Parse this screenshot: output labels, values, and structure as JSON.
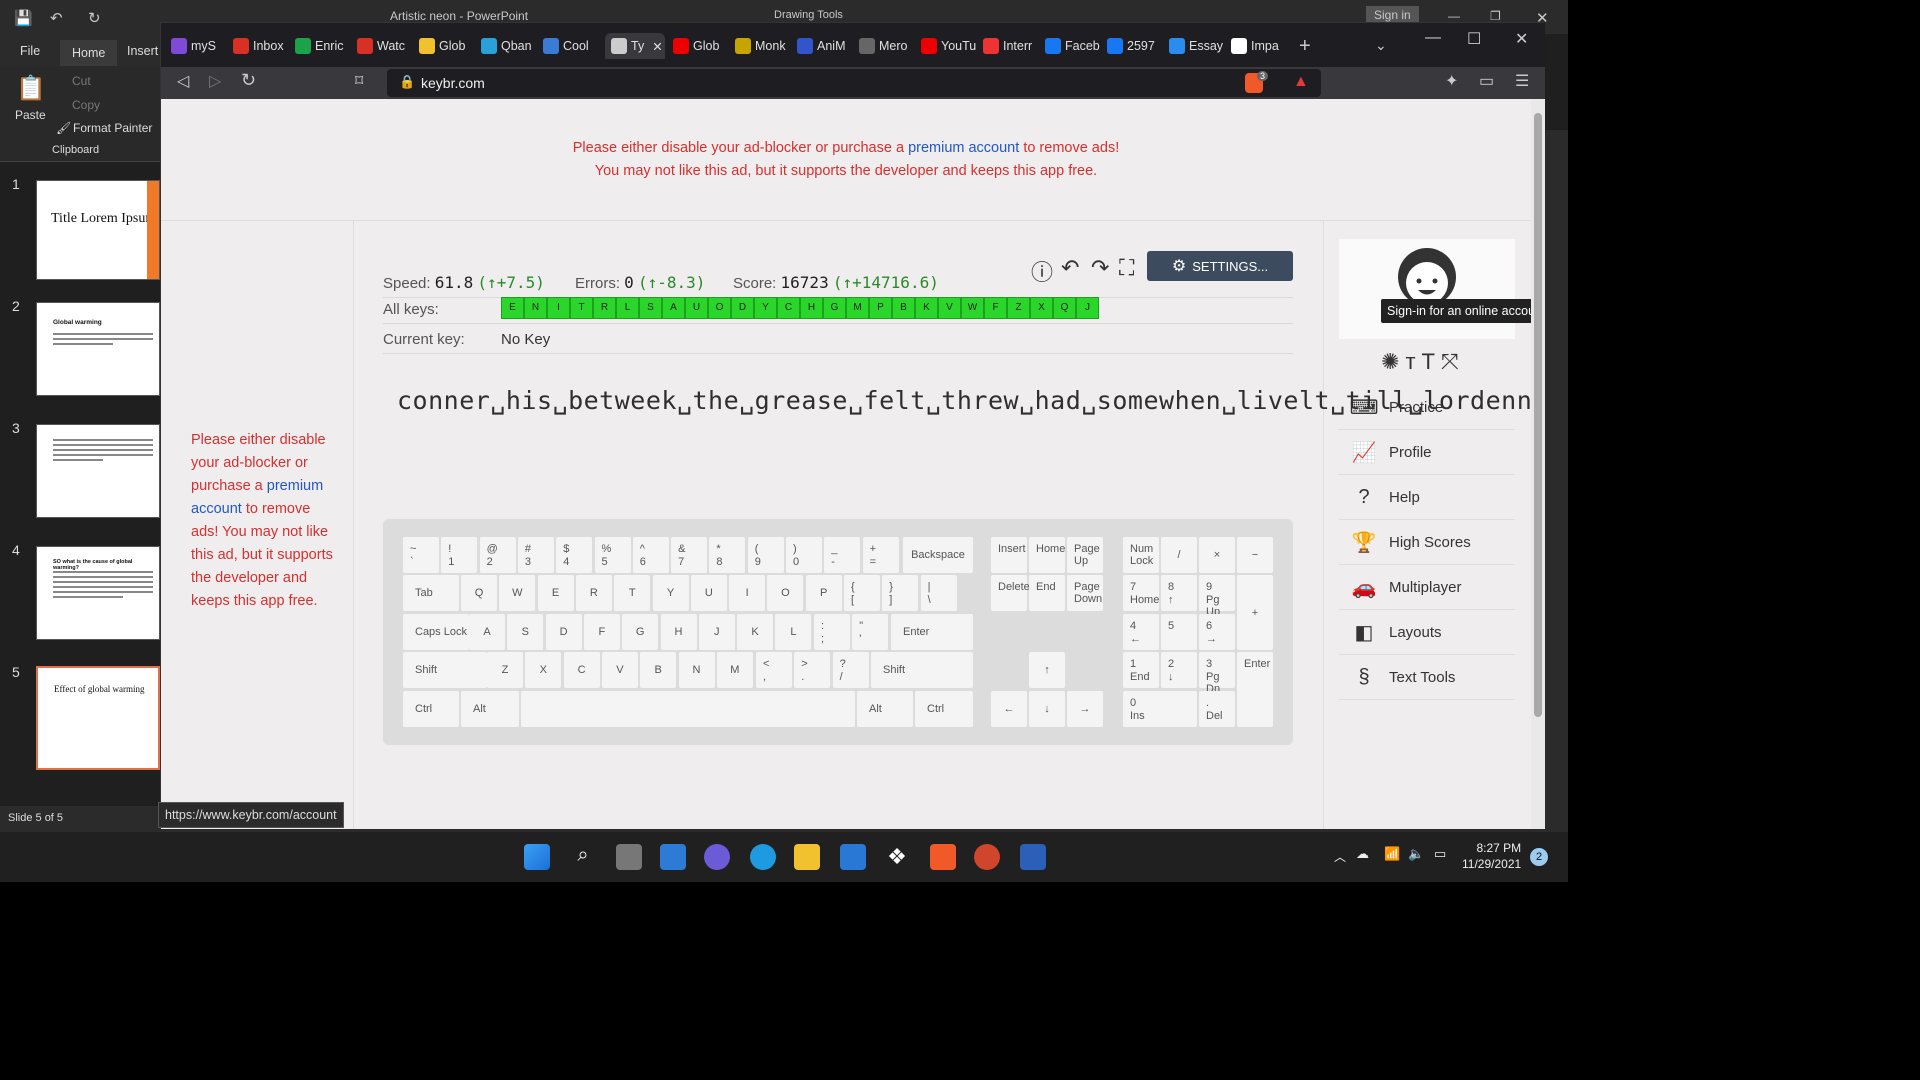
{
  "powerpoint": {
    "title": "Artistic neon  -  PowerPoint",
    "drawing_tools": "Drawing Tools",
    "sign_in": "Sign in",
    "tabs": [
      "File",
      "Home",
      "Insert"
    ],
    "clipboard": {
      "paste": "Paste",
      "cut": "Cut",
      "copy": "Copy",
      "format_painter": "Format Painter",
      "group": "Clipboard"
    },
    "slides": [
      {
        "num": "1",
        "title": "Title Lorem Ipsum"
      },
      {
        "num": "2",
        "title": "Global warming"
      },
      {
        "num": "3",
        "title": ""
      },
      {
        "num": "4",
        "title": "SO what is the cause of global warming?"
      },
      {
        "num": "5",
        "title": "Effect of global warming"
      }
    ],
    "status": "Slide 5 of 5"
  },
  "browser": {
    "tabs": [
      "myS",
      "Inbox",
      "Enric",
      "Watc",
      "Glob",
      "Qban",
      "Cool",
      "Ty",
      "Glob",
      "Monk",
      "AniM",
      "Mero",
      "YouTu",
      "Interr",
      "Faceb",
      "2597",
      "Essay",
      "Impa"
    ],
    "url": "keybr.com",
    "status_url": "https://www.keybr.com/account",
    "shield_count": "3"
  },
  "ad": {
    "line1_pre": "Please either disable your ad-blocker or purchase a",
    "link": "premium account",
    "line1_post": "to remove ads!",
    "line2": "You may not like this ad, but it supports the developer and keeps this app free.",
    "left_pre": "Please either disable your ad-blocker or purchase a",
    "left_post": "to remove ads! You may not like this ad, but it supports the developer and keeps this app free."
  },
  "stats": {
    "speed_label": "Speed:",
    "speed": "61.8",
    "speed_delta": "(↑+7.5)",
    "errors_label": "Errors:",
    "errors": "0",
    "errors_delta": "(↑-8.3)",
    "score_label": "Score:",
    "score": "16723",
    "score_delta": "(↑+14716.6)",
    "all_keys_label": "All keys:",
    "current_key_label": "Current key:",
    "current_key": "No Key",
    "settings": "SETTINGS..."
  },
  "all_keys": [
    "E",
    "N",
    "I",
    "T",
    "R",
    "L",
    "S",
    "A",
    "U",
    "O",
    "D",
    "Y",
    "C",
    "H",
    "G",
    "M",
    "P",
    "B",
    "K",
    "V",
    "W",
    "F",
    "Z",
    "X",
    "Q",
    "J"
  ],
  "typing_text": "conner␣his␣betweek␣the␣grease␣felt␣threw␣had␣somewhen␣livelt␣till␣lordennet␣that␣very␣solves␣ins␣engage␣sist␣smild␣turned",
  "sidebar": {
    "tooltip": "Sign-in for an online account.",
    "nav": [
      "Practice",
      "Profile",
      "Help",
      "High Scores",
      "Multiplayer",
      "Layouts",
      "Text Tools"
    ]
  },
  "keyboard": {
    "row1": [
      [
        "~",
        "`"
      ],
      [
        "!",
        "1"
      ],
      [
        "@",
        "2"
      ],
      [
        "#",
        "3"
      ],
      [
        "$",
        "4"
      ],
      [
        "%",
        "5"
      ],
      [
        "^",
        "6"
      ],
      [
        "&",
        "7"
      ],
      [
        "*",
        "8"
      ],
      [
        "(",
        "9"
      ],
      [
        ")",
        "0"
      ],
      [
        "_",
        "-"
      ],
      [
        "+",
        "="
      ]
    ],
    "row2": [
      "Q",
      "W",
      "E",
      "R",
      "T",
      "Y",
      "U",
      "I",
      "O",
      "P"
    ],
    "row2b": [
      [
        "{",
        "["
      ],
      [
        "}",
        "]"
      ],
      [
        "|",
        "\\"
      ]
    ],
    "row3": [
      "A",
      "S",
      "D",
      "F",
      "G",
      "H",
      "J",
      "K",
      "L"
    ],
    "row3b": [
      [
        ":",
        ";"
      ],
      [
        "\"",
        "'"
      ]
    ],
    "row4": [
      "Z",
      "X",
      "C",
      "V",
      "B",
      "N",
      "M"
    ],
    "row4b": [
      [
        "<",
        ","
      ],
      [
        ">",
        "."
      ],
      [
        "?",
        "/"
      ]
    ],
    "labels": {
      "backspace": "Backspace",
      "tab": "Tab",
      "caps": "Caps Lock",
      "enter": "Enter",
      "shift": "Shift",
      "ctrl": "Ctrl",
      "alt": "Alt",
      "insert": "Insert",
      "home": "Home",
      "pageup": "Page Up",
      "delete": "Delete",
      "end": "End",
      "pagedown": "Page Down",
      "numlock": "Num Lock",
      "up": "↑",
      "left": "←",
      "down": "↓",
      "right": "→"
    },
    "numpad": {
      "slash": "/",
      "star": "×",
      "minus": "−",
      "plus": "+",
      "enter": "Enter",
      "k7": "7",
      "h7": "Home",
      "k8": "8",
      "h8": "↑",
      "k9": "9",
      "h9": "Pg Up",
      "k4": "4",
      "h4": "←",
      "k5": "5",
      "k6": "6",
      "h6": "→",
      "k1": "1",
      "h1": "End",
      "k2": "2",
      "h2": "↓",
      "k3": "3",
      "h3": "Pg Dn",
      "k0": "0",
      "h0": "Ins",
      "kd": ".",
      "hd": "Del"
    }
  },
  "taskbar": {
    "time": "8:27 PM",
    "date": "11/29/2021",
    "badge": "2"
  }
}
